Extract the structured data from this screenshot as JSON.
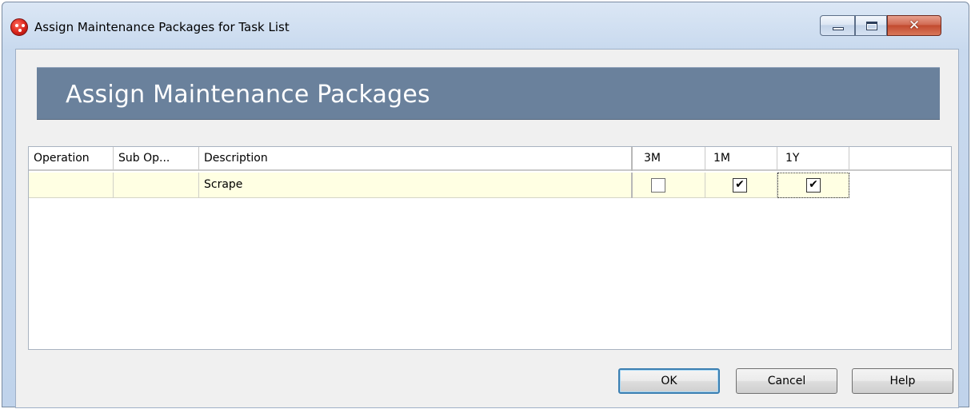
{
  "window": {
    "title": "Assign Maintenance Packages for Task List",
    "close_glyph": "✕"
  },
  "header": {
    "title": "Assign Maintenance Packages"
  },
  "grid": {
    "columns": [
      "Operation",
      "Sub Op...",
      "Description",
      "3M",
      "1M",
      "1Y"
    ],
    "rows": [
      {
        "operation": "",
        "sub_op": "",
        "description": "Scrape",
        "checks": {
          "3M": false,
          "1M": true,
          "1Y": true
        },
        "check_glyph_3M": "",
        "check_glyph_1M": "✔",
        "check_glyph_1Y": "✔"
      }
    ],
    "row_background": "#ffffe3"
  },
  "buttons": {
    "ok": "OK",
    "cancel": "Cancel",
    "help": "Help"
  },
  "colors": {
    "header_band": "#6a819c",
    "default_button_border": "#3c7fb1"
  }
}
